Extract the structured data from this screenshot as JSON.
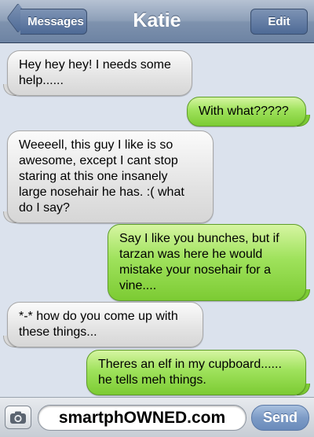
{
  "navbar": {
    "back_label": "Messages",
    "title": "Katie",
    "edit_label": "Edit"
  },
  "messages": [
    {
      "direction": "received",
      "text": "Hey hey hey! I needs some\nhelp......"
    },
    {
      "direction": "sent",
      "text": "With what?????"
    },
    {
      "direction": "received",
      "text": "Weeeell, this guy I like is so\nawesome, except I cant stop\nstaring at this one insanely\nlarge nosehair he has. :( what\ndo I say?"
    },
    {
      "direction": "sent",
      "text": "Say I like you bunches, but if\ntarzan was here he would\nmistake your nosehair for a\nvine...."
    },
    {
      "direction": "received",
      "text": "*-* how do you come up with\nthese things..."
    },
    {
      "direction": "sent",
      "text": "Theres an elf in my cupboard......\nhe tells meh things."
    }
  ],
  "input_bar": {
    "camera_icon": "camera-icon",
    "field_text": "smartphOWNED.com",
    "send_label": "Send"
  },
  "colors": {
    "received_bubble": "#e3e3e3",
    "sent_bubble": "#9fe25c",
    "navbar": "#8d9fb8",
    "background": "#dbe2ed"
  }
}
